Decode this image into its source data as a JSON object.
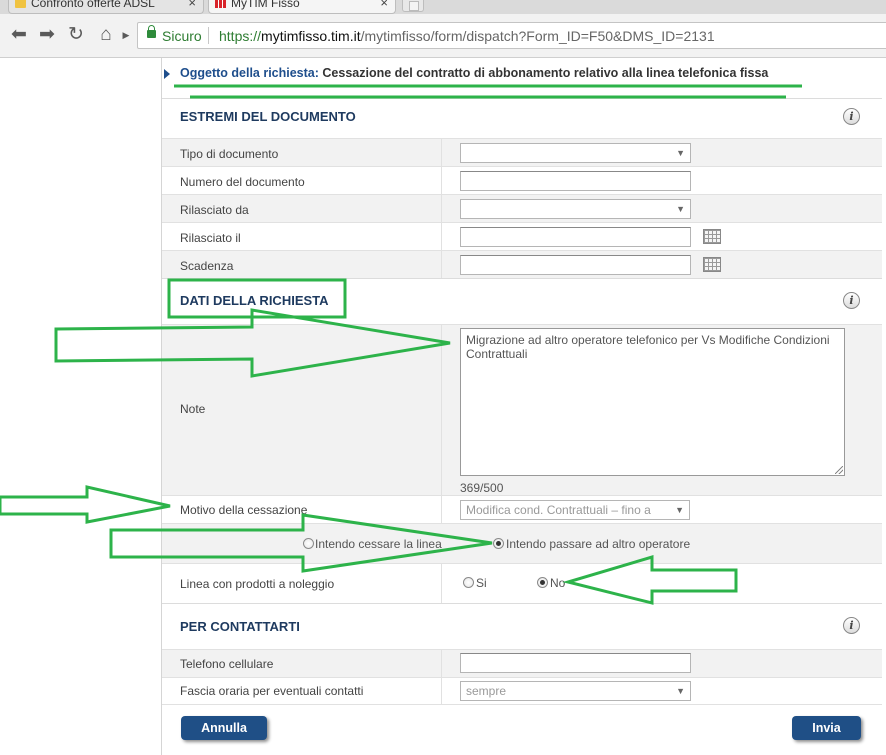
{
  "browser": {
    "tabs": [
      {
        "label": "Confronto offerte ADSL",
        "active": false
      },
      {
        "label": "MyTIM Fisso",
        "active": true
      }
    ],
    "security_label": "Sicuro",
    "url_scheme": "https://",
    "url_host": "mytimfisso.tim.it",
    "url_path": "/mytimfisso/form/dispatch?Form_ID=F50&DMS_ID=2131"
  },
  "subject": {
    "label": "Oggetto della richiesta:",
    "value": "Cessazione del contratto di abbonamento relativo alla linea telefonica fissa"
  },
  "sections": {
    "document": {
      "title": "ESTREMI DEL DOCUMENTO",
      "rows": {
        "tipo": "Tipo di documento",
        "numero": "Numero del documento",
        "rilasciato_da": "Rilasciato da",
        "rilasciato_il": "Rilasciato il",
        "scadenza": "Scadenza"
      }
    },
    "request": {
      "title": "DATI DELLA RICHIESTA",
      "note_label": "Note",
      "note_text": "Migrazione ad altro operatore telefonico per Vs Modifiche Condizioni Contrattuali",
      "note_counter": "369/500",
      "motivo_label": "Motivo della cessazione",
      "motivo_value": "Modifica cond. Contrattuali – fino a",
      "option_cessare": "Intendo cessare la linea",
      "option_passare": "Intendo passare ad altro operatore",
      "noleggio_label": "Linea con prodotti a noleggio",
      "noleggio_si": "Si",
      "noleggio_no": "No"
    },
    "contact": {
      "title": "PER CONTATTARTI",
      "telefono_label": "Telefono cellulare",
      "fascia_label": "Fascia oraria per eventuali contatti",
      "fascia_value": "sempre"
    }
  },
  "buttons": {
    "cancel": "Annulla",
    "submit": "Invia"
  },
  "colors": {
    "accent": "#1f4f86",
    "section_title": "#1e3a5f",
    "annotation": "#2db34a"
  }
}
